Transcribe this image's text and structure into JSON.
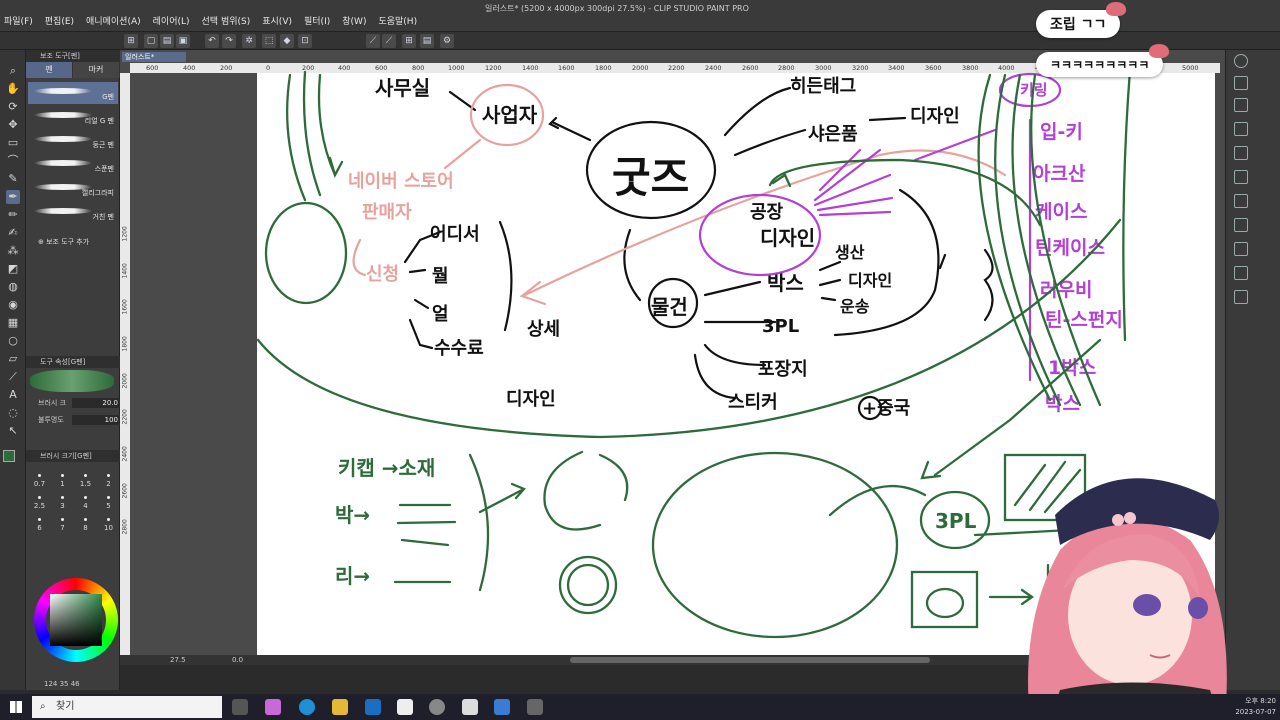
{
  "window": {
    "title": "일러스트* (5200 x 4000px 300dpi 27.5%) - CLIP STUDIO PAINT PRO",
    "menu": [
      "파일(F)",
      "편집(E)",
      "애니메이션(A)",
      "레이어(L)",
      "선택 범위(S)",
      "표시(V)",
      "필터(I)",
      "창(W)",
      "도움말(H)"
    ]
  },
  "subtool": {
    "header": "보조 도구[펜]",
    "tabs": [
      "펜",
      "마커"
    ],
    "brushes": [
      "G펜",
      "리얼 G 펜",
      "둥근 펜",
      "스푼펜",
      "캘리그라피",
      "거친 펜"
    ],
    "add_label": "보조 도구 추가"
  },
  "tool_property": {
    "header": "도구 속성[G펜]",
    "brush_size_label": "브러시 크",
    "brush_size_value": "20.0",
    "opacity_label": "불투명도",
    "opacity_value": "100"
  },
  "brush_size_panel": {
    "header": "브러시 크기[G펜]",
    "sizes": [
      "0.7",
      "1",
      "1.5",
      "2",
      "2.5",
      "3",
      "4",
      "5",
      "6",
      "7",
      "8",
      "10"
    ]
  },
  "colors": {
    "main": "#2e6b3a",
    "sub": "#ffffff"
  },
  "canvas": {
    "doc_tab": "일러스트*",
    "ruler_h": [
      "600",
      "400",
      "200",
      "0",
      "200",
      "400",
      "600",
      "800",
      "1000",
      "1200",
      "1400",
      "1600",
      "1800",
      "2000",
      "2200",
      "2400",
      "2600",
      "2800",
      "3000",
      "3200",
      "3400",
      "3600",
      "3800",
      "4000",
      "4200",
      "4400",
      "4600",
      "4800",
      "5000"
    ],
    "ruler_v": [
      "1200",
      "1400",
      "1600",
      "1800",
      "2000",
      "2200",
      "2400",
      "2600",
      "2800"
    ],
    "zoom": "27.5",
    "angle": "0.0"
  },
  "sketch": {
    "center": "굿즈",
    "business": "사업자",
    "office": "사무실",
    "naver": "네이버 스토어",
    "seller": "판매자",
    "apply": "신청",
    "where": "어디서",
    "what": "뭘",
    "when": "얼",
    "fee": "수수료",
    "detail1": "상세",
    "detail2": "디자인",
    "tag": "히든태그",
    "product": "샤은품",
    "design_top": "디자인",
    "factory": "공장",
    "design_mid": "디자인",
    "box": "박스",
    "produce": "생산",
    "design_r": "디자인",
    "ship": "운송",
    "goods": "물건",
    "tpl": "3PL",
    "wrap": "포장지",
    "sticker": "스티커",
    "china": "+중국",
    "list": [
      "키링",
      "입-키",
      "아크산",
      "케이스",
      "틴케이스",
      "러우비",
      "틴-스펀지",
      "1박스",
      "박스"
    ],
    "bottom1": "키캡 →소재",
    "bottom2": "박→",
    "bottom3": "리→",
    "bottom_tpl": "3PL"
  },
  "chat": {
    "msg1": "조립 ㄱㄱ",
    "msg2": "ㅋㅋㅋㅋㅋㅋㅋㅋㅋ"
  },
  "taskbar": {
    "search": "찾기",
    "time": "오후 8:20",
    "date": "2023-07-07"
  },
  "readout": "124 35 46"
}
